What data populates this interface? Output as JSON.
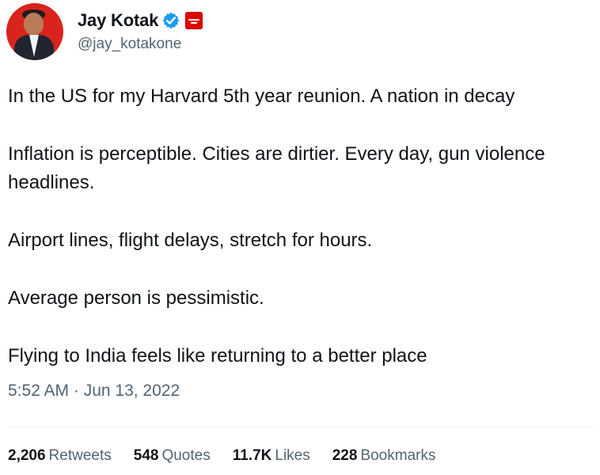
{
  "author": {
    "name": "Jay Kotak",
    "handle": "@jay_kotakone",
    "avatar_icon": "profile-photo",
    "verified_icon": "verified-badge-icon",
    "affiliation_icon": "affiliation-badge-icon",
    "verified_color": "#1d9bf0",
    "affiliation_color": "#e10600"
  },
  "tweet": {
    "paragraphs": [
      "In the US for my Harvard 5th year reunion. A nation in decay",
      "Inflation is perceptible. Cities are dirtier. Every day, gun violence headlines.",
      "Airport lines, flight delays, stretch for hours.",
      "Average person is pessimistic.",
      "Flying to India feels like returning to a better place"
    ],
    "timestamp": "5:52 AM · Jun 13, 2022"
  },
  "stats": [
    {
      "value": "2,206",
      "label": "Retweets"
    },
    {
      "value": "548",
      "label": "Quotes"
    },
    {
      "value": "11.7K",
      "label": "Likes"
    },
    {
      "value": "228",
      "label": "Bookmarks"
    }
  ]
}
